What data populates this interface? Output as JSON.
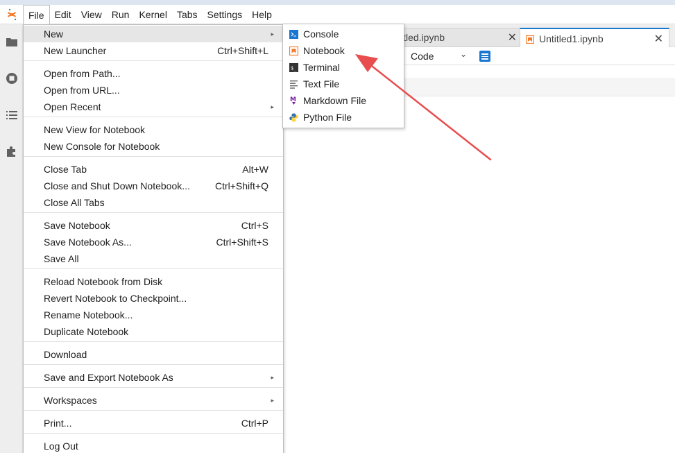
{
  "menubar": {
    "items": [
      "File",
      "Edit",
      "View",
      "Run",
      "Kernel",
      "Tabs",
      "Settings",
      "Help"
    ],
    "active": "File"
  },
  "tabs": [
    {
      "label": "Untitled.ipynb",
      "visible_label": "itled.ipynb",
      "close": "✕"
    },
    {
      "label": "Untitled1.ipynb",
      "visible_label": "Untitled1.ipynb",
      "close": "✕"
    }
  ],
  "toolbar": {
    "cell_type": "Code",
    "caret": "⌄"
  },
  "file_menu": {
    "items": [
      {
        "label": "New",
        "shortcut": "",
        "submenu": true
      },
      {
        "label": "New Launcher",
        "shortcut": "Ctrl+Shift+L",
        "submenu": false
      },
      {
        "label": "Open from Path...",
        "shortcut": "",
        "submenu": false
      },
      {
        "label": "Open from URL...",
        "shortcut": "",
        "submenu": false
      },
      {
        "label": "Open Recent",
        "shortcut": "",
        "submenu": true
      },
      {
        "label": "New View for Notebook",
        "shortcut": "",
        "submenu": false
      },
      {
        "label": "New Console for Notebook",
        "shortcut": "",
        "submenu": false
      },
      {
        "label": "Close Tab",
        "shortcut": "Alt+W",
        "submenu": false
      },
      {
        "label": "Close and Shut Down Notebook...",
        "shortcut": "Ctrl+Shift+Q",
        "submenu": false
      },
      {
        "label": "Close All Tabs",
        "shortcut": "",
        "submenu": false
      },
      {
        "label": "Save Notebook",
        "shortcut": "Ctrl+S",
        "submenu": false
      },
      {
        "label": "Save Notebook As...",
        "shortcut": "Ctrl+Shift+S",
        "submenu": false
      },
      {
        "label": "Save All",
        "shortcut": "",
        "submenu": false
      },
      {
        "label": "Reload Notebook from Disk",
        "shortcut": "",
        "submenu": false
      },
      {
        "label": "Revert Notebook to Checkpoint...",
        "shortcut": "",
        "submenu": false
      },
      {
        "label": "Rename Notebook...",
        "shortcut": "",
        "submenu": false
      },
      {
        "label": "Duplicate Notebook",
        "shortcut": "",
        "submenu": false
      },
      {
        "label": "Download",
        "shortcut": "",
        "submenu": false
      },
      {
        "label": "Save and Export Notebook As",
        "shortcut": "",
        "submenu": true
      },
      {
        "label": "Workspaces",
        "shortcut": "",
        "submenu": true
      },
      {
        "label": "Print...",
        "shortcut": "Ctrl+P",
        "submenu": false
      },
      {
        "label": "Log Out",
        "shortcut": "",
        "submenu": false
      }
    ],
    "submenu_arrow": "▸"
  },
  "new_menu": {
    "items": [
      "Console",
      "Notebook",
      "Terminal",
      "Text File",
      "Markdown File",
      "Python File"
    ],
    "icons": [
      "console-icon",
      "notebook-icon",
      "terminal-icon",
      "text-file-icon",
      "markdown-file-icon",
      "python-file-icon"
    ]
  },
  "colors": {
    "accent": "#1976d2",
    "notebook_orange": "#f37726",
    "markdown_purple": "#7b1fa2",
    "annotation_red": "#e84e4e"
  }
}
